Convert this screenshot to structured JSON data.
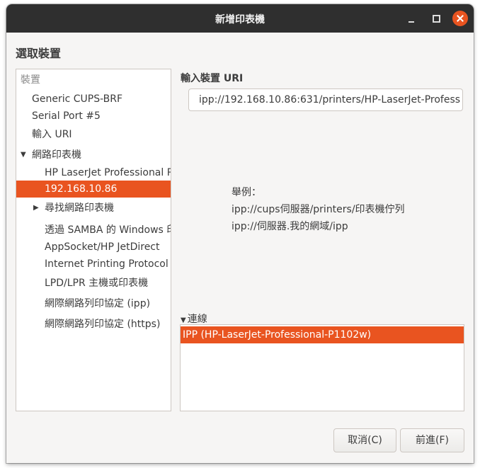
{
  "window": {
    "title": "新增印表機",
    "controls": [
      "minimize-icon",
      "maximize-icon",
      "close-icon"
    ],
    "accent": "#e95420",
    "titlebar_bg": "#2f2f2f"
  },
  "heading": "選取裝置",
  "device_tree": {
    "header": "裝置",
    "items": [
      {
        "label": "Generic CUPS-BRF"
      },
      {
        "label": "Serial Port #5"
      },
      {
        "label": "輸入 URI"
      },
      {
        "label": "網路印表機"
      },
      {
        "label": "HP LaserJet Professional P"
      },
      {
        "label": "192.168.10.86"
      },
      {
        "label": "尋找網路印表機"
      },
      {
        "label": "透過 SAMBA 的 Windows 印"
      },
      {
        "label": "AppSocket/HP JetDirect"
      },
      {
        "label": "Internet Printing Protocol ("
      },
      {
        "label": "LPD/LPR 主機或印表機"
      },
      {
        "label": "網際網路列印協定 (ipp)"
      },
      {
        "label": "網際網路列印協定 (https)"
      }
    ]
  },
  "uri": {
    "label": "輸入裝置 URI",
    "value": "ipp://192.168.10.86:631/printers/HP-LaserJet-Profess"
  },
  "example": {
    "title": "舉例：",
    "line1": "ipp://cups伺服器/printers/印表機佇列",
    "line2": "ipp://伺服器.我的網域/ipp"
  },
  "connection": {
    "label": "連線",
    "items": [
      {
        "label": "IPP (HP-LaserJet-Professional-P1102w)"
      }
    ]
  },
  "buttons": {
    "cancel": "取消(C)",
    "forward": "前進(F)"
  }
}
